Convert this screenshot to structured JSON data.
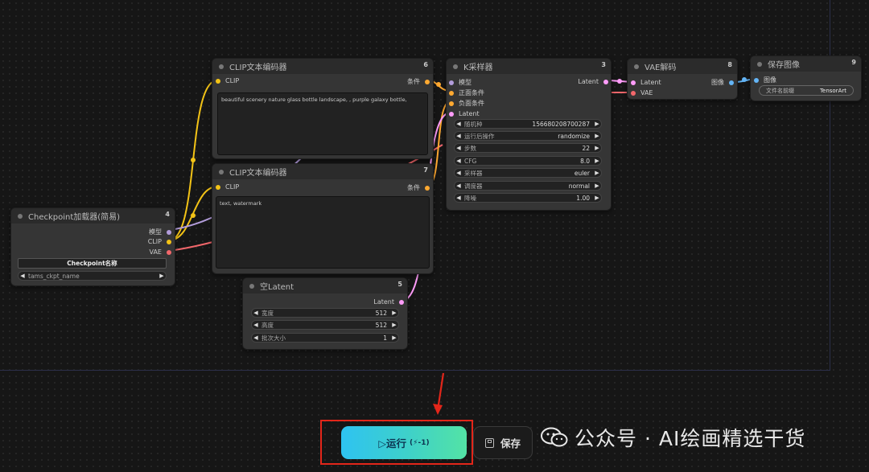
{
  "nodes": {
    "clip_top": {
      "title": "CLIP文本编码器",
      "num": "6",
      "in_clip": "CLIP",
      "out_cond": "条件",
      "text": "beautiful scenery nature glass bottle landscape, , purple galaxy bottle,"
    },
    "clip_bottom": {
      "title": "CLIP文本编码器",
      "num": "7",
      "in_clip": "CLIP",
      "out_cond": "条件",
      "text": "text, watermark"
    },
    "ksampler": {
      "title": "K采样器",
      "num": "3",
      "in_model": "模型",
      "in_pos": "正面条件",
      "in_neg": "负面条件",
      "in_latent": "Latent",
      "out_latent": "Latent",
      "widgets": [
        {
          "label": "随机种",
          "value": "156680208700287"
        },
        {
          "label": "运行后操作",
          "value": "randomize"
        },
        {
          "label": "步数",
          "value": "22"
        },
        {
          "label": "CFG",
          "value": "8.0"
        },
        {
          "label": "采样器",
          "value": "euler"
        },
        {
          "label": "调度器",
          "value": "normal"
        },
        {
          "label": "降噪",
          "value": "1.00"
        }
      ]
    },
    "vae": {
      "title": "VAE解码",
      "num": "8",
      "in_latent": "Latent",
      "in_vae": "VAE",
      "out_image": "图像"
    },
    "save": {
      "title": "保存图像",
      "num": "9",
      "in_image": "图像",
      "filename_label": "文件名前缀",
      "filename_value": "TensorArt"
    },
    "checkpoint": {
      "title": "Checkpoint加载器(简易)",
      "num": "4",
      "out_model": "模型",
      "out_clip": "CLIP",
      "out_vae": "VAE",
      "button_label": "Checkpoint名称",
      "ckpt_value": "tams_ckpt_name"
    },
    "latent": {
      "title": "空Latent",
      "num": "5",
      "out_latent": "Latent",
      "widgets": [
        {
          "label": "宽度",
          "value": "512"
        },
        {
          "label": "高度",
          "value": "512"
        },
        {
          "label": "批次大小",
          "value": "1"
        }
      ]
    }
  },
  "toolbar": {
    "run_label": "▷运行",
    "run_badge": "(⚡-1)",
    "save_label": "保存"
  },
  "watermark": {
    "text": "公众号 · AI绘画精选干货"
  },
  "colors": {
    "clip": "#f3c316",
    "model": "#b39ddb",
    "vae": "#f2676b",
    "latent": "#ff9cf9",
    "cond": "#ffa931",
    "image": "#64b5f6",
    "run_gradient_start": "#2ec3f1",
    "run_gradient_end": "#53e3a5",
    "highlight": "#e3261a"
  }
}
